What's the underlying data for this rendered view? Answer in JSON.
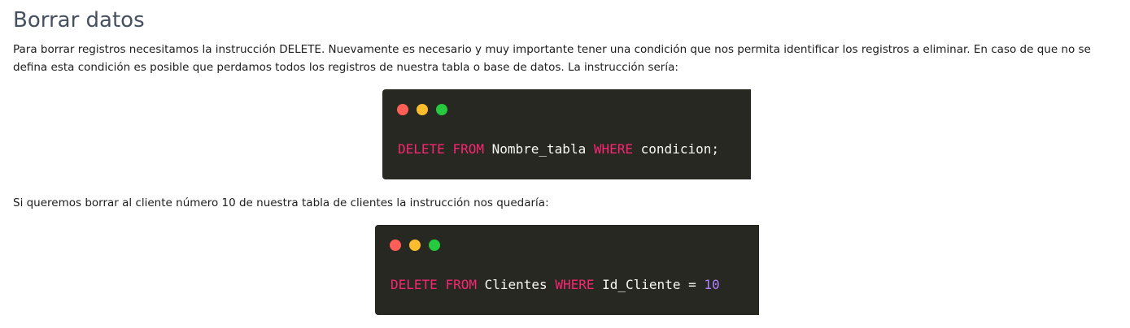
{
  "title": "Borrar datos",
  "intro": "Para borrar registros necesitamos la instrucción DELETE. Nuevamente es necesario y muy importante tener una condición que nos permita identificar los registros a eliminar. En caso de que no se defina esta condición es posible que perdamos todos los registros de nuestra tabla o base de datos. La instrucción sería:",
  "example_intro": "Si queremos borrar al cliente número 10 de nuestra tabla de clientes la instrucción nos quedaría:",
  "window_dots": {
    "close_color": "#ff5f56",
    "minimize_color": "#ffbd2e",
    "maximize_color": "#27c93f"
  },
  "code_colors": {
    "background": "#272822",
    "keyword": "#f92672",
    "identifier": "#f8f8f2",
    "number": "#ae81ff"
  },
  "code_block_1": {
    "kw_delete": "DELETE",
    "kw_from": "FROM",
    "table": "Nombre_tabla",
    "kw_where": "WHERE",
    "condition": "condicion;"
  },
  "code_block_2": {
    "kw_delete": "DELETE",
    "kw_from": "FROM",
    "table": "Clientes",
    "kw_where": "WHERE",
    "column": "Id_Cliente",
    "operator": "=",
    "value": "10"
  }
}
